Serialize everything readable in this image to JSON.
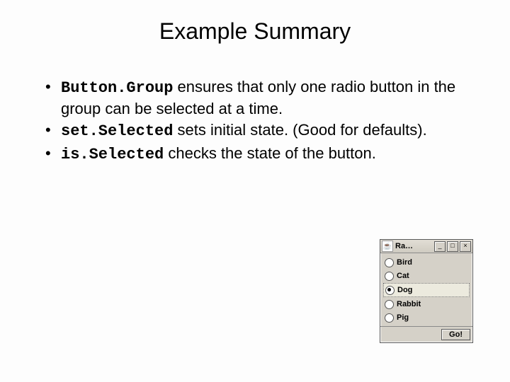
{
  "title": "Example Summary",
  "bullets": [
    {
      "mono": "Button.Group",
      "rest": " ensures that only one radio button in the group can be selected at a time."
    },
    {
      "mono": "set.Selected",
      "rest": " sets initial state.  (Good for defaults)."
    },
    {
      "mono": "is.Selected",
      "rest": " checks the state of the button."
    }
  ],
  "window": {
    "java_icon": "☕",
    "title": "Ra…",
    "min": "_",
    "max": "□",
    "close": "×",
    "options": [
      "Bird",
      "Cat",
      "Dog",
      "Rabbit",
      "Pig"
    ],
    "selected_index": 2,
    "go_label": "Go!"
  }
}
